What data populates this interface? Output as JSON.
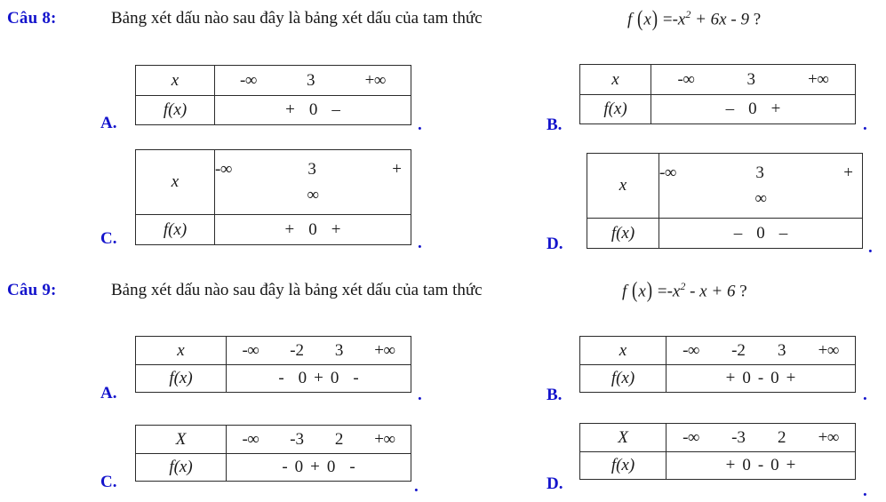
{
  "page": {
    "background": "#ffffff",
    "label_color": "#1414cc",
    "text_color": "#161616"
  },
  "questions": [
    {
      "label": "Câu 8:",
      "prompt": "Bảng xét dấu nào sau đây là bảng xét dấu của tam thức",
      "formula": "f(x) = -x² + 6x - 9 ?",
      "formula_parts": {
        "fn": "f",
        "arg": "x",
        "eq": "=",
        "body": "-x",
        "power": "2",
        "rest": "+ 6x - 9",
        "qmark": "?"
      },
      "options": [
        {
          "letter": "A.",
          "row_header_x": "x",
          "row_header_f": "f(x)",
          "x_values": [
            "-∞",
            "3",
            "+∞"
          ],
          "sign_values": [
            "+",
            "0",
            "–"
          ],
          "wrapped": false,
          "trailing_dot": "."
        },
        {
          "letter": "B.",
          "row_header_x": "x",
          "row_header_f": "f(x)",
          "x_values": [
            "-∞",
            "3",
            "+∞"
          ],
          "sign_values": [
            "–",
            "0",
            "+"
          ],
          "wrapped": false,
          "trailing_dot": "."
        },
        {
          "letter": "C.",
          "row_header_x": "x",
          "row_header_f": "f(x)",
          "x_values": [
            "-∞",
            "3",
            "+"
          ],
          "x_wrap_overflow": "∞",
          "sign_values": [
            "+",
            "0",
            "+"
          ],
          "wrapped": true,
          "trailing_dot": "."
        },
        {
          "letter": "D.",
          "row_header_x": "x",
          "row_header_f": "f(x)",
          "x_values": [
            "-∞",
            "3",
            "+"
          ],
          "x_wrap_overflow": "∞",
          "sign_values": [
            "–",
            "0",
            "–"
          ],
          "wrapped": true,
          "trailing_dot": "."
        }
      ]
    },
    {
      "label": "Câu 9:",
      "prompt": "Bảng xét dấu nào sau đây là bảng xét dấu của tam thức",
      "formula": "f(x) = -x² - x + 6 ?",
      "formula_parts": {
        "fn": "f",
        "arg": "x",
        "eq": "=",
        "body": "-x",
        "power": "2",
        "rest": "- x + 6",
        "qmark": "?"
      },
      "options": [
        {
          "letter": "A.",
          "row_header_x": "x",
          "row_header_f": "f(x)",
          "x_values": [
            "-∞",
            "-2",
            "3",
            "+∞"
          ],
          "sign_values": [
            "-",
            "0",
            "+",
            "0",
            "-"
          ],
          "sign_text": "-  0 + 0   -",
          "wrapped": false,
          "trailing_dot": "."
        },
        {
          "letter": "B.",
          "row_header_x": "x",
          "row_header_f": "f(x)",
          "x_values": [
            "-∞",
            "-2",
            "3",
            "+∞"
          ],
          "sign_values": [
            "+",
            "0",
            "-",
            "0",
            "+"
          ],
          "sign_text": "+ 0 - 0  +",
          "wrapped": false,
          "trailing_dot": "."
        },
        {
          "letter": "C.",
          "row_header_x": "X",
          "row_header_f": "f(x)",
          "x_values": [
            "-∞",
            "-3",
            "2",
            "+∞"
          ],
          "sign_values": [
            "-",
            "0",
            "+",
            "0",
            "-"
          ],
          "sign_text": "- 0 + 0  -",
          "wrapped": false,
          "trailing_dot": "."
        },
        {
          "letter": "D.",
          "row_header_x": "X",
          "row_header_f": "f(x)",
          "x_values": [
            "-∞",
            "-3",
            "2",
            "+∞"
          ],
          "sign_values": [
            "+",
            "0",
            "-",
            "0",
            "+"
          ],
          "sign_text": "+ 0 - 0 +",
          "wrapped": false,
          "trailing_dot": "."
        }
      ]
    }
  ]
}
